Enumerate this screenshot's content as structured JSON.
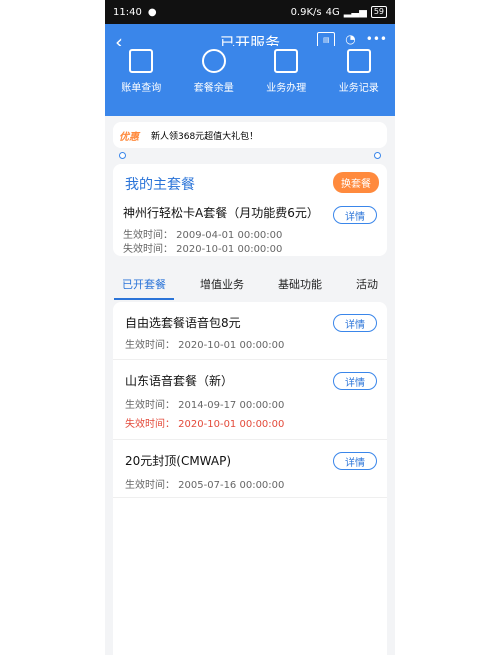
{
  "status": {
    "time": "11:40",
    "speed": "0.9K/s",
    "battery": "59",
    "network_label": "4G"
  },
  "header": {
    "title": "已开服务",
    "back_icon": "back-arrow-icon",
    "right_icons": [
      "notes-icon",
      "headset-icon",
      "more-icon"
    ]
  },
  "quick_actions": [
    {
      "label": "账单查询",
      "icon": "bill-icon"
    },
    {
      "label": "套餐余量",
      "icon": "pie-icon"
    },
    {
      "label": "业务办理",
      "icon": "edit-icon"
    },
    {
      "label": "业务记录",
      "icon": "list-icon"
    }
  ],
  "banner": {
    "tag": "优惠",
    "text": "新人领368元超值大礼包！"
  },
  "main_plan": {
    "title": "我的主套餐",
    "switch_label": "换套餐",
    "name": "神州行轻松卡A套餐（月功能费6元）",
    "detail_label": "详情",
    "effective": "生效时间：  2009-04-01  00:00:00",
    "expire": "失效时间：  2020-10-01  00:00:00"
  },
  "tabs": [
    {
      "label": "已开套餐",
      "active": true
    },
    {
      "label": "增值业务",
      "active": false
    },
    {
      "label": "基础功能",
      "active": false
    },
    {
      "label": "活动",
      "active": false
    }
  ],
  "services": [
    {
      "title": "自由选套餐语音包8元",
      "detail_label": "详情",
      "effective": "生效时间：  2020-10-01  00:00:00"
    },
    {
      "title": "山东语音套餐（新）",
      "detail_label": "详情",
      "effective": "生效时间：  2014-09-17  00:00:00",
      "expire": "失效时间：  2020-10-01  00:00:00"
    },
    {
      "title": "20元封顶(CMWAP)",
      "detail_label": "详情",
      "effective": "生效时间：  2005-07-16  00:00:00"
    }
  ],
  "colors": {
    "primary": "#3a86ea",
    "accent": "#ff8a3d",
    "expire_red": "#e34a3a"
  }
}
